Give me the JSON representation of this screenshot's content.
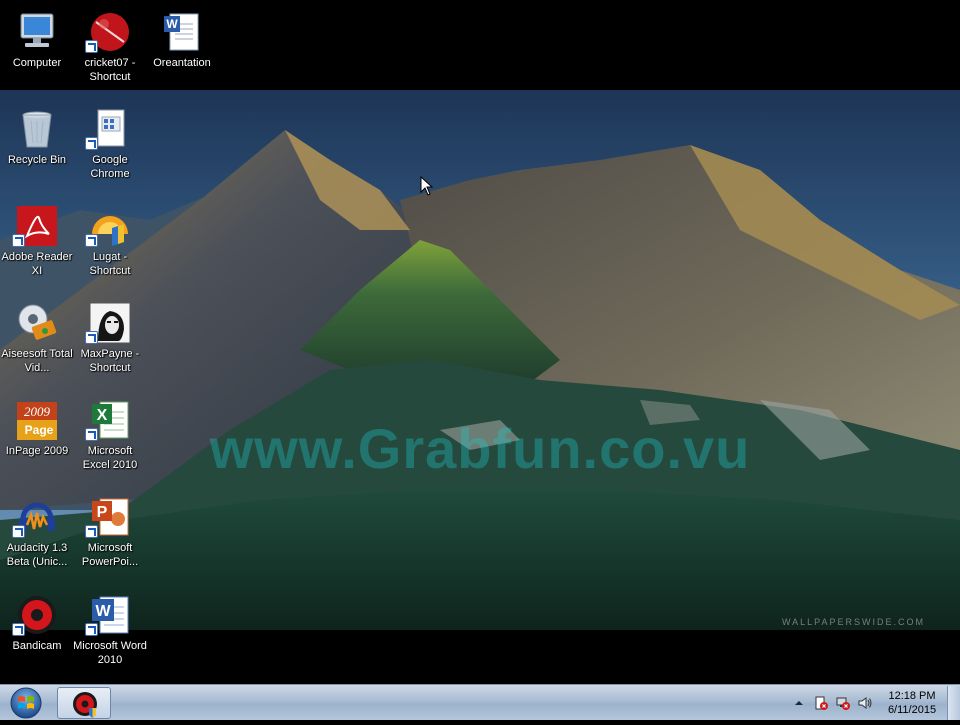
{
  "desktop_icons": [
    {
      "label": "Computer",
      "icon": "computer-icon"
    },
    {
      "label": "cricket07 - Shortcut",
      "icon": "cricket-ball-icon"
    },
    {
      "label": "Oreantation",
      "icon": "word-document-icon"
    },
    {
      "label": "Recycle Bin",
      "icon": "recycle-bin-icon"
    },
    {
      "label": "Google Chrome",
      "icon": "chrome-shortcut-icon"
    },
    {
      "label": "Adobe Reader XI",
      "icon": "adobe-reader-icon"
    },
    {
      "label": "Lugat - Shortcut",
      "icon": "lugat-icon"
    },
    {
      "label": "Aiseesoft Total Vid...",
      "icon": "aiseesoft-icon"
    },
    {
      "label": "MaxPayne - Shortcut",
      "icon": "maxpayne-icon"
    },
    {
      "label": "InPage 2009",
      "icon": "inpage-icon"
    },
    {
      "label": "Microsoft Excel 2010",
      "icon": "excel-icon"
    },
    {
      "label": "Audacity 1.3 Beta (Unic...",
      "icon": "audacity-icon"
    },
    {
      "label": "Microsoft PowerPoi...",
      "icon": "powerpoint-icon"
    },
    {
      "label": "Bandicam",
      "icon": "bandicam-icon"
    },
    {
      "label": "Microsoft Word 2010",
      "icon": "word-icon"
    }
  ],
  "wallpaper": {
    "watermark": "www.Grabfun.co.vu",
    "credit": "WALLPAPERSWIDE.COM"
  },
  "taskbar": {
    "start_icon": "windows-logo-icon",
    "pinned_app_icon": "bandicam-icon",
    "tray_icons": [
      "show-hidden-icons-icon",
      "action-center-icon",
      "network-icon",
      "volume-icon"
    ],
    "clock_time": "12:18 PM",
    "clock_date": "6/11/2015"
  }
}
